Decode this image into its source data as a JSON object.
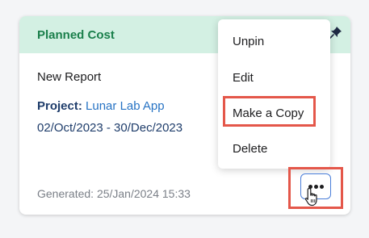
{
  "card": {
    "title": "Planned Cost",
    "report_name": "New Report",
    "project_label": "Project:",
    "project_value": "Lunar Lab App",
    "date_range": "02/Oct/2023 - 30/Dec/2023",
    "generated": "Generated: 25/Jan/2024 15:33"
  },
  "menu": {
    "items": [
      {
        "label": "Unpin"
      },
      {
        "label": "Edit"
      },
      {
        "label": "Make a Copy"
      },
      {
        "label": "Delete"
      }
    ]
  },
  "icons": {
    "pin": "pin-icon",
    "more": "more-options-icon",
    "cursor": "hand-pointer-cursor-icon"
  },
  "colors": {
    "header_bg": "#d3f0e3",
    "title": "#1a7f4b",
    "highlight": "#e4574a",
    "link": "#2773c4"
  }
}
